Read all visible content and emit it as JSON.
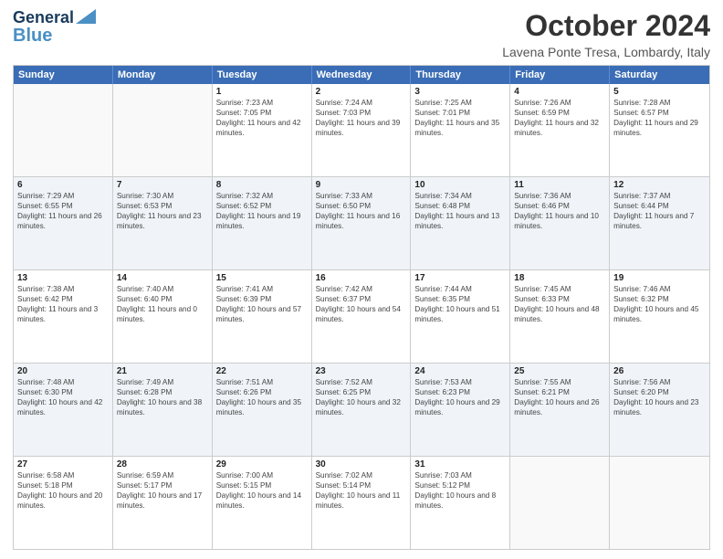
{
  "header": {
    "logo_line1": "General",
    "logo_line2": "Blue",
    "month": "October 2024",
    "location": "Lavena Ponte Tresa, Lombardy, Italy"
  },
  "days": [
    "Sunday",
    "Monday",
    "Tuesday",
    "Wednesday",
    "Thursday",
    "Friday",
    "Saturday"
  ],
  "rows": [
    [
      {
        "day": "",
        "content": ""
      },
      {
        "day": "",
        "content": ""
      },
      {
        "day": "1",
        "content": "Sunrise: 7:23 AM\nSunset: 7:05 PM\nDaylight: 11 hours and 42 minutes."
      },
      {
        "day": "2",
        "content": "Sunrise: 7:24 AM\nSunset: 7:03 PM\nDaylight: 11 hours and 39 minutes."
      },
      {
        "day": "3",
        "content": "Sunrise: 7:25 AM\nSunset: 7:01 PM\nDaylight: 11 hours and 35 minutes."
      },
      {
        "day": "4",
        "content": "Sunrise: 7:26 AM\nSunset: 6:59 PM\nDaylight: 11 hours and 32 minutes."
      },
      {
        "day": "5",
        "content": "Sunrise: 7:28 AM\nSunset: 6:57 PM\nDaylight: 11 hours and 29 minutes."
      }
    ],
    [
      {
        "day": "6",
        "content": "Sunrise: 7:29 AM\nSunset: 6:55 PM\nDaylight: 11 hours and 26 minutes."
      },
      {
        "day": "7",
        "content": "Sunrise: 7:30 AM\nSunset: 6:53 PM\nDaylight: 11 hours and 23 minutes."
      },
      {
        "day": "8",
        "content": "Sunrise: 7:32 AM\nSunset: 6:52 PM\nDaylight: 11 hours and 19 minutes."
      },
      {
        "day": "9",
        "content": "Sunrise: 7:33 AM\nSunset: 6:50 PM\nDaylight: 11 hours and 16 minutes."
      },
      {
        "day": "10",
        "content": "Sunrise: 7:34 AM\nSunset: 6:48 PM\nDaylight: 11 hours and 13 minutes."
      },
      {
        "day": "11",
        "content": "Sunrise: 7:36 AM\nSunset: 6:46 PM\nDaylight: 11 hours and 10 minutes."
      },
      {
        "day": "12",
        "content": "Sunrise: 7:37 AM\nSunset: 6:44 PM\nDaylight: 11 hours and 7 minutes."
      }
    ],
    [
      {
        "day": "13",
        "content": "Sunrise: 7:38 AM\nSunset: 6:42 PM\nDaylight: 11 hours and 3 minutes."
      },
      {
        "day": "14",
        "content": "Sunrise: 7:40 AM\nSunset: 6:40 PM\nDaylight: 11 hours and 0 minutes."
      },
      {
        "day": "15",
        "content": "Sunrise: 7:41 AM\nSunset: 6:39 PM\nDaylight: 10 hours and 57 minutes."
      },
      {
        "day": "16",
        "content": "Sunrise: 7:42 AM\nSunset: 6:37 PM\nDaylight: 10 hours and 54 minutes."
      },
      {
        "day": "17",
        "content": "Sunrise: 7:44 AM\nSunset: 6:35 PM\nDaylight: 10 hours and 51 minutes."
      },
      {
        "day": "18",
        "content": "Sunrise: 7:45 AM\nSunset: 6:33 PM\nDaylight: 10 hours and 48 minutes."
      },
      {
        "day": "19",
        "content": "Sunrise: 7:46 AM\nSunset: 6:32 PM\nDaylight: 10 hours and 45 minutes."
      }
    ],
    [
      {
        "day": "20",
        "content": "Sunrise: 7:48 AM\nSunset: 6:30 PM\nDaylight: 10 hours and 42 minutes."
      },
      {
        "day": "21",
        "content": "Sunrise: 7:49 AM\nSunset: 6:28 PM\nDaylight: 10 hours and 38 minutes."
      },
      {
        "day": "22",
        "content": "Sunrise: 7:51 AM\nSunset: 6:26 PM\nDaylight: 10 hours and 35 minutes."
      },
      {
        "day": "23",
        "content": "Sunrise: 7:52 AM\nSunset: 6:25 PM\nDaylight: 10 hours and 32 minutes."
      },
      {
        "day": "24",
        "content": "Sunrise: 7:53 AM\nSunset: 6:23 PM\nDaylight: 10 hours and 29 minutes."
      },
      {
        "day": "25",
        "content": "Sunrise: 7:55 AM\nSunset: 6:21 PM\nDaylight: 10 hours and 26 minutes."
      },
      {
        "day": "26",
        "content": "Sunrise: 7:56 AM\nSunset: 6:20 PM\nDaylight: 10 hours and 23 minutes."
      }
    ],
    [
      {
        "day": "27",
        "content": "Sunrise: 6:58 AM\nSunset: 5:18 PM\nDaylight: 10 hours and 20 minutes."
      },
      {
        "day": "28",
        "content": "Sunrise: 6:59 AM\nSunset: 5:17 PM\nDaylight: 10 hours and 17 minutes."
      },
      {
        "day": "29",
        "content": "Sunrise: 7:00 AM\nSunset: 5:15 PM\nDaylight: 10 hours and 14 minutes."
      },
      {
        "day": "30",
        "content": "Sunrise: 7:02 AM\nSunset: 5:14 PM\nDaylight: 10 hours and 11 minutes."
      },
      {
        "day": "31",
        "content": "Sunrise: 7:03 AM\nSunset: 5:12 PM\nDaylight: 10 hours and 8 minutes."
      },
      {
        "day": "",
        "content": ""
      },
      {
        "day": "",
        "content": ""
      }
    ]
  ]
}
